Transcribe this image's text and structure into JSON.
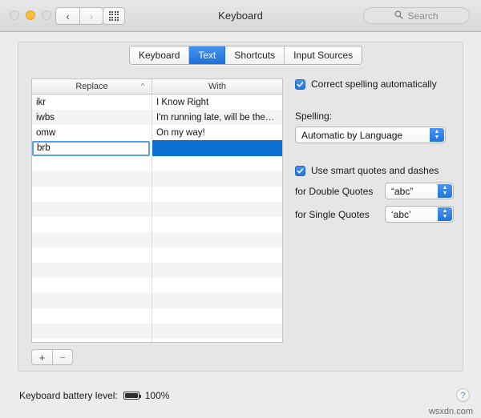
{
  "window": {
    "title": "Keyboard",
    "traffic_lights": [
      "close",
      "minimize",
      "zoom"
    ],
    "nav_back_icon": "chevron-left-icon",
    "nav_forward_icon": "chevron-right-icon",
    "show_all_icon": "grid-icon"
  },
  "search": {
    "placeholder": "Search",
    "value": "",
    "icon": "search-icon"
  },
  "tabs": [
    {
      "label": "Keyboard",
      "active": false
    },
    {
      "label": "Text",
      "active": true
    },
    {
      "label": "Shortcuts",
      "active": false
    },
    {
      "label": "Input Sources",
      "active": false
    }
  ],
  "table": {
    "columns": [
      {
        "label": "Replace",
        "sort": "ascending",
        "sort_icon": "chevron-up-icon"
      },
      {
        "label": "With",
        "sort": "none"
      }
    ],
    "rows": [
      {
        "replace": "ikr",
        "with": "I Know Right"
      },
      {
        "replace": "iwbs",
        "with": "I'm running late, will be the…"
      },
      {
        "replace": "omw",
        "with": "On my way!"
      }
    ],
    "editing_row": {
      "replace_value": "brb",
      "with_value": "",
      "selected": true
    },
    "empty_rows": 12
  },
  "table_buttons": {
    "add_label": "+",
    "remove_label": "−"
  },
  "options": {
    "correct_spelling": {
      "label": "Correct spelling automatically",
      "checked": true
    },
    "spelling_label": "Spelling:",
    "spelling_value": "Automatic by Language",
    "smart_quotes": {
      "label": "Use smart quotes and dashes",
      "checked": true
    },
    "double_quotes_label": "for Double Quotes",
    "double_quotes_value": "“abc”",
    "single_quotes_label": "for Single Quotes",
    "single_quotes_value": "‘abc’"
  },
  "status": {
    "battery_label": "Keyboard battery level:",
    "battery_percent": "100%",
    "battery_icon": "battery-full-icon",
    "help_label": "?"
  },
  "watermark": "wsxdn.com",
  "colors": {
    "accent": "#1f75da",
    "selection": "#0a6fd0",
    "window_bg": "#ececec",
    "panel_bg": "#e6e6e6"
  }
}
